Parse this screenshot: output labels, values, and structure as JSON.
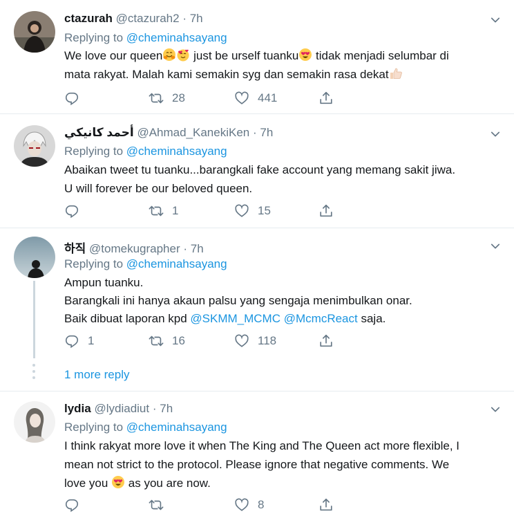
{
  "tweets": [
    {
      "name": "ctazurah",
      "handle": "@ctazurah2",
      "time": "7h",
      "replying_label": "Replying to",
      "replying_to": "@cheminahsayang",
      "line1_a": "We love our queen",
      "line1_b": " just be urself tuanku",
      "line1_c": " tidak menjadi selumbar di",
      "line2": "mata rakyat. Malah kami semakin syg dan semakin rasa dekat",
      "retweets": "28",
      "likes": "441"
    },
    {
      "name": "أحمد كانيكي",
      "handle": "@Ahmad_KanekiKen",
      "time": "7h",
      "replying_label": "Replying to",
      "replying_to": "@cheminahsayang",
      "line1": "Abaikan tweet tu tuanku...barangkali fake account yang memang sakit jiwa.",
      "line2": "U will forever be our beloved queen.",
      "retweets": "1",
      "likes": "15"
    },
    {
      "name": "하직",
      "handle": "@tomekugrapher",
      "time": "7h",
      "replying_label": "Replying to",
      "replying_to": "@cheminahsayang",
      "line1": "Ampun tuanku.",
      "line2": "Barangkali ini hanya akaun palsu yang sengaja menimbulkan onar.",
      "line3_a": "Baik dibuat laporan kpd ",
      "line3_m1": "@SKMM_MCMC",
      "line3_m2": "@McmcReact",
      "line3_b": " saja.",
      "replies": "1",
      "retweets": "16",
      "likes": "118"
    },
    {
      "name": "lydia",
      "handle": "@lydiadiut",
      "time": "7h",
      "replying_label": "Replying to",
      "replying_to": "@cheminahsayang",
      "line1": "I think rakyat more love it when The King and The Queen act more flexible, I",
      "line2": "mean not strict to the protocol. Please ignore that negative comments. We",
      "line3_a": "love you ",
      "line3_b": " as you are now.",
      "likes": "8"
    }
  ],
  "more_replies": "1 more reply",
  "separator": "·"
}
